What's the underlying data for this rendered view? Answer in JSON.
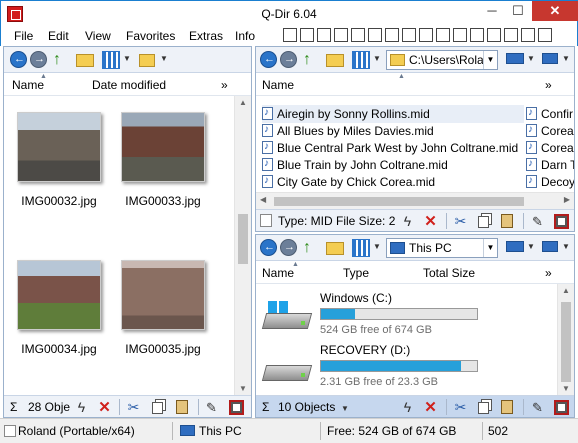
{
  "window": {
    "title": "Q-Dir 6.04",
    "min_glyph": "─",
    "max_glyph": "☐",
    "close_glyph": "✕"
  },
  "menu": {
    "items": [
      "File",
      "Edit",
      "View",
      "Favorites",
      "Extras",
      "Info"
    ]
  },
  "pane_left": {
    "columns": [
      "Name",
      "Date modified"
    ],
    "more": "»",
    "thumbnails": [
      "IMG00032.jpg",
      "IMG00033.jpg",
      "IMG00034.jpg",
      "IMG00035.jpg"
    ],
    "status": {
      "sigma": "Σ",
      "count": "28 Obje"
    }
  },
  "pane_top_right": {
    "address": "C:\\Users\\Rola",
    "columns": [
      "Name"
    ],
    "more": "»",
    "files_col1": [
      "Airegin by Sonny Rollins.mid",
      "All Blues by Miles Davies.mid",
      "Blue Central Park West by John Coltrane.mid",
      "Blue Train by John Coltrane.mid",
      "City Gate by Chick Corea.mid"
    ],
    "files_col2": [
      "Confir",
      "Corea",
      "Corea",
      "Darn T",
      "Decoy"
    ],
    "status": {
      "type_info": "Type: MID File Size: 2"
    }
  },
  "pane_bottom_right": {
    "address": "This PC",
    "columns": [
      "Name",
      "Type",
      "Total Size"
    ],
    "more": "»",
    "drives": [
      {
        "name": "Windows (C:)",
        "free": "524 GB free of 674 GB",
        "used_fraction": 0.22
      },
      {
        "name": "RECOVERY (D:)",
        "free": "2.31 GB free of 23.3 GB",
        "used_fraction": 0.9
      }
    ],
    "status": {
      "sigma": "Σ",
      "count": "10 Objects"
    }
  },
  "global_status": {
    "user": "Roland (Portable/x64)",
    "location": "This PC",
    "free": "Free: 524 GB of 674 GB",
    "number": "502"
  },
  "colors": {
    "accent": "#1a7fd0",
    "close": "#c7372f",
    "drive_bar": "#26a0da",
    "status_blue": "#c6d7ee"
  }
}
